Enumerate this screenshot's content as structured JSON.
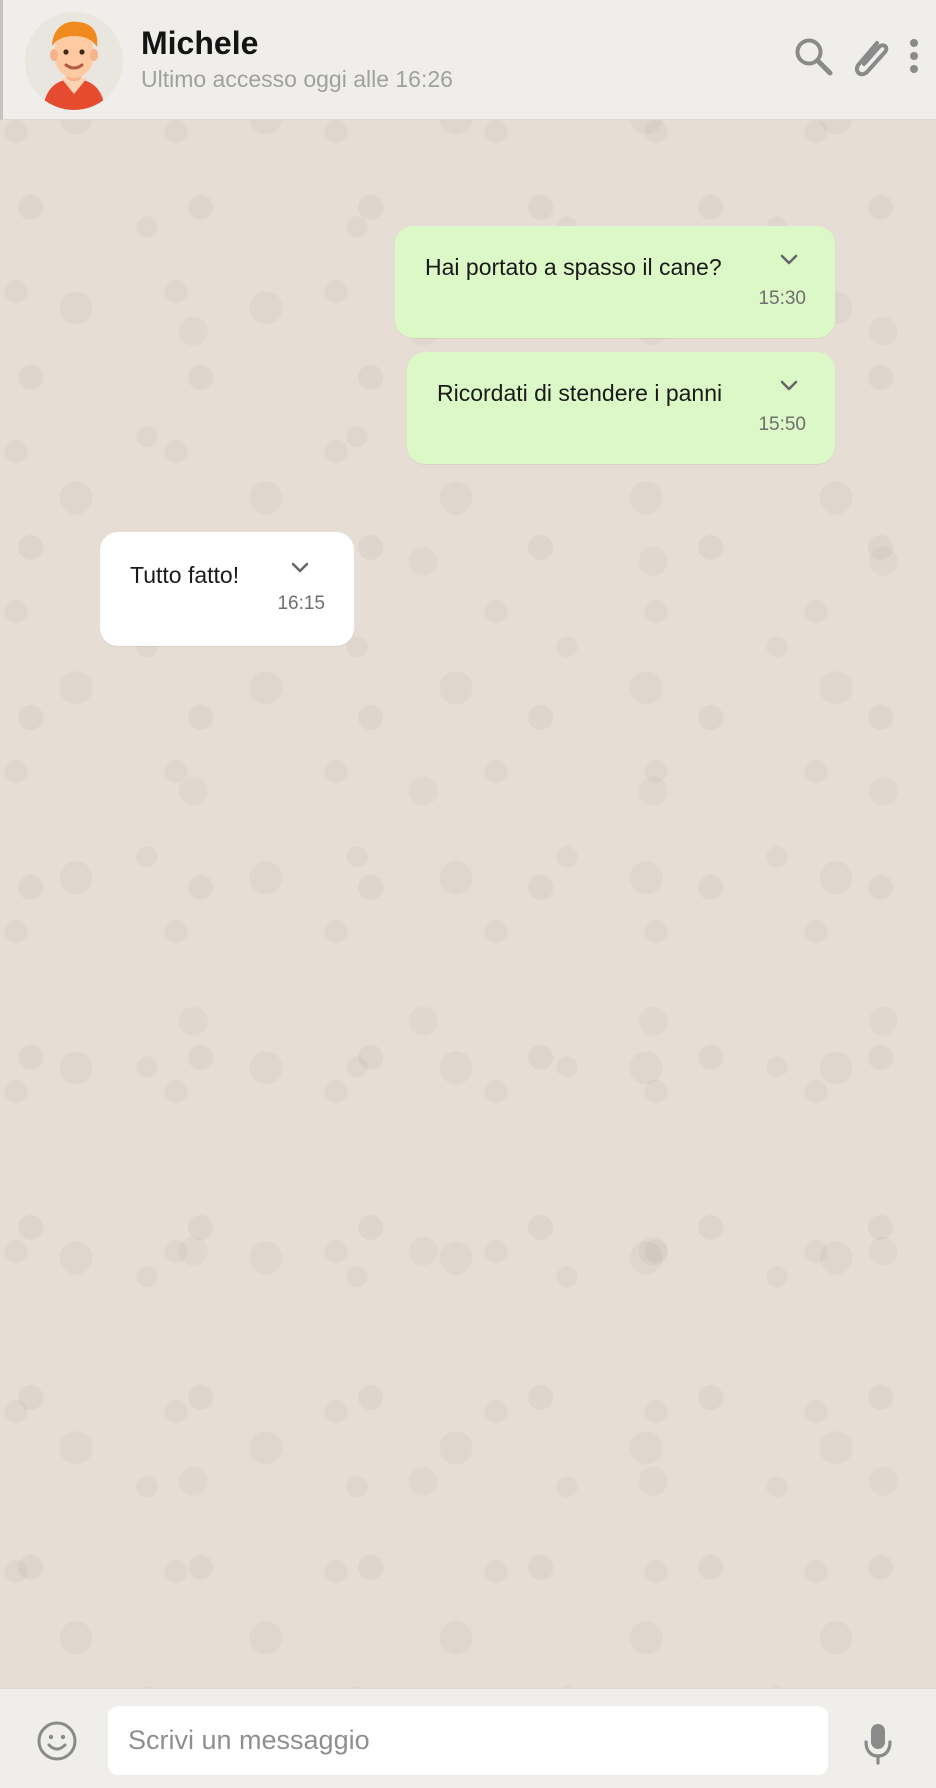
{
  "header": {
    "contact_name": "Michele",
    "last_seen": "Ultimo accesso oggi alle 16:26",
    "actions": {
      "search_icon": "search-icon",
      "attach_icon": "paperclip-icon",
      "menu_icon": "more-vertical-icon"
    }
  },
  "messages": [
    {
      "direction": "sent",
      "text": "Hai portato a spasso il cane?",
      "time": "15:30",
      "icon": "chevron-down-icon"
    },
    {
      "direction": "sent",
      "text": "Ricordati di stendere i panni",
      "time": "15:50",
      "icon": "chevron-down-icon"
    },
    {
      "direction": "received",
      "text": "Tutto fatto!",
      "time": "16:15",
      "icon": "chevron-down-icon"
    }
  ],
  "composer": {
    "placeholder": "Scrivi un messaggio",
    "emoji_icon": "emoji-icon",
    "mic_icon": "microphone-icon"
  },
  "colors": {
    "header_bg": "#f0eeeb",
    "chat_bg": "#e6ded4",
    "sent_bubble": "#dcf8c6",
    "received_bubble": "#ffffff",
    "icon_gray": "#8a8a8a"
  }
}
